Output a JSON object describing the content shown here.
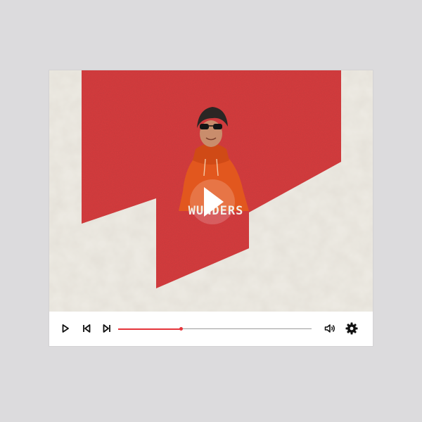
{
  "video": {
    "poster_text": "WUNDERS",
    "colors": {
      "brand_red": "#d63a3c",
      "background_cream": "#ece9e2",
      "hoodie_orange": "#e2571e"
    }
  },
  "overlay": {
    "icon": "play-icon"
  },
  "controls": {
    "play_icon": "play-icon",
    "previous_icon": "skip-back-icon",
    "next_icon": "skip-forward-icon",
    "volume_icon": "volume-icon",
    "settings_icon": "gear-icon",
    "progress_fraction": 0.325,
    "accent_color": "#e5343a"
  }
}
